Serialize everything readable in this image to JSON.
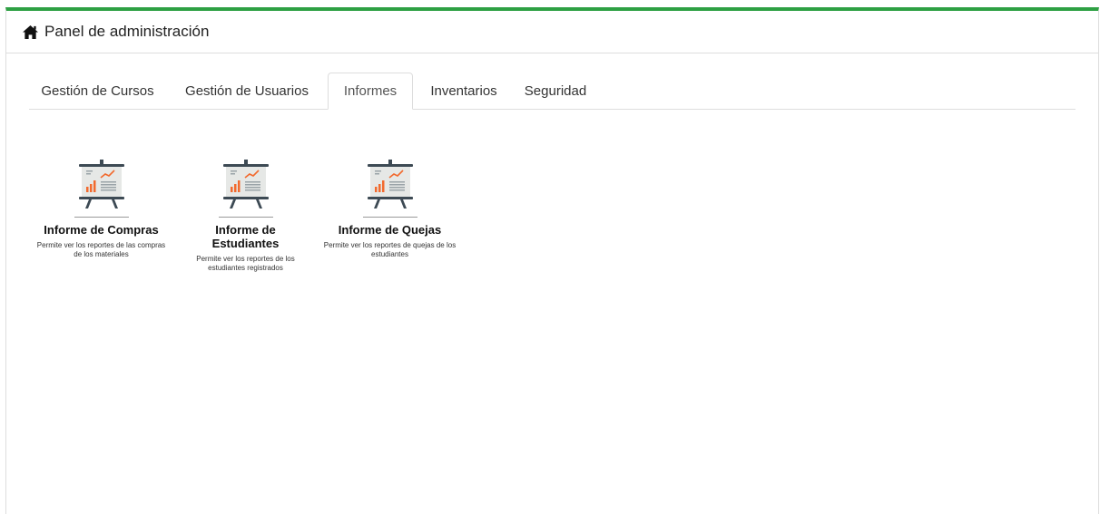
{
  "panel": {
    "title": "Panel de administración",
    "icon": "home-icon",
    "accent_color": "#2ea043"
  },
  "tabs": [
    {
      "label": "Gestión de Cursos",
      "active": false
    },
    {
      "label": "Gestión de Usuarios",
      "active": false
    },
    {
      "label": "Informes",
      "active": true
    },
    {
      "label": "Inventarios",
      "active": false
    },
    {
      "label": "Seguridad",
      "active": false
    }
  ],
  "cards": [
    {
      "icon": "presentation-chart-icon",
      "title": "Informe de Compras",
      "description": "Permite ver los reportes de las compras de los materiales"
    },
    {
      "icon": "presentation-chart-icon",
      "title": "Informe de Estudiantes",
      "description": "Permite ver los reportes de los estudiantes registrados"
    },
    {
      "icon": "presentation-chart-icon",
      "title": "Informe de Quejas",
      "description": "Permite ver los reportes de quejas de los estudiantes"
    }
  ]
}
